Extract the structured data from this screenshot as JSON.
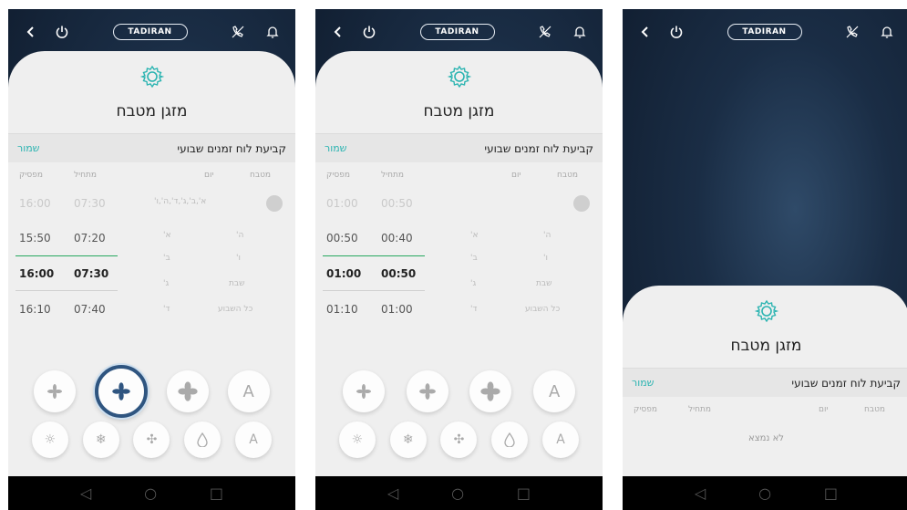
{
  "brand": "TADIRAN",
  "screens": [
    {
      "title": "מזגן מטבח",
      "schedule_label": "קביעת לוח זמנים שבועי",
      "save_label": "שמור",
      "columns": {
        "end": "מפסיק",
        "start": "מתחיל",
        "day": "יום",
        "mode": "מטבח"
      },
      "first_row": {
        "end": "16:00",
        "start": "07:30",
        "days": "א',ב',ג',ד',ה',ו'"
      },
      "time_rows": [
        {
          "end": "15:50",
          "start": "07:20",
          "state": "mid"
        },
        {
          "end": "16:00",
          "start": "07:30",
          "state": "sel"
        },
        {
          "end": "16:10",
          "start": "07:40",
          "state": "mid"
        }
      ],
      "day_letters": [
        "א'",
        "ב'",
        "ג'",
        "ד'"
      ],
      "day_options": [
        "ה'",
        "ו'",
        "שבת",
        "כל השבוע"
      ]
    },
    {
      "title": "מזגן מטבח",
      "schedule_label": "קביעת לוח זמנים שבועי",
      "save_label": "שמור",
      "columns": {
        "end": "מפסיק",
        "start": "מתחיל",
        "day": "יום",
        "mode": "מטבח"
      },
      "first_row": {
        "end": "01:00",
        "start": "00:50",
        "days": ""
      },
      "time_rows": [
        {
          "end": "00:50",
          "start": "00:40",
          "state": "mid"
        },
        {
          "end": "01:00",
          "start": "00:50",
          "state": "sel"
        },
        {
          "end": "01:10",
          "start": "01:00",
          "state": "mid"
        }
      ],
      "day_letters": [
        "א'",
        "ב'",
        "ג'",
        "ד'"
      ],
      "day_options": [
        "ה'",
        "ו'",
        "שבת",
        "כל השבוע"
      ]
    },
    {
      "title": "מזגן מטבח",
      "schedule_label": "קביעת לוח זמנים שבועי",
      "save_label": "שמור",
      "columns": {
        "end": "מפסיק",
        "start": "מתחיל",
        "day": "יום",
        "mode": "מטבח"
      },
      "empty_text": "לא נמצא"
    }
  ],
  "mode_buttons": [
    "fan-low-icon",
    "fan-mid-icon",
    "fan-high-icon",
    "auto-fan-icon"
  ],
  "mode_auto_label": "A",
  "func_buttons": [
    "sun-icon",
    "snowflake-icon",
    "fan-icon",
    "drop-icon",
    "auto-icon"
  ],
  "func_auto_label": "A",
  "colors": {
    "accent": "#2bb4b1",
    "active_ring": "#2f5580",
    "selected_line": "#27a85f"
  }
}
